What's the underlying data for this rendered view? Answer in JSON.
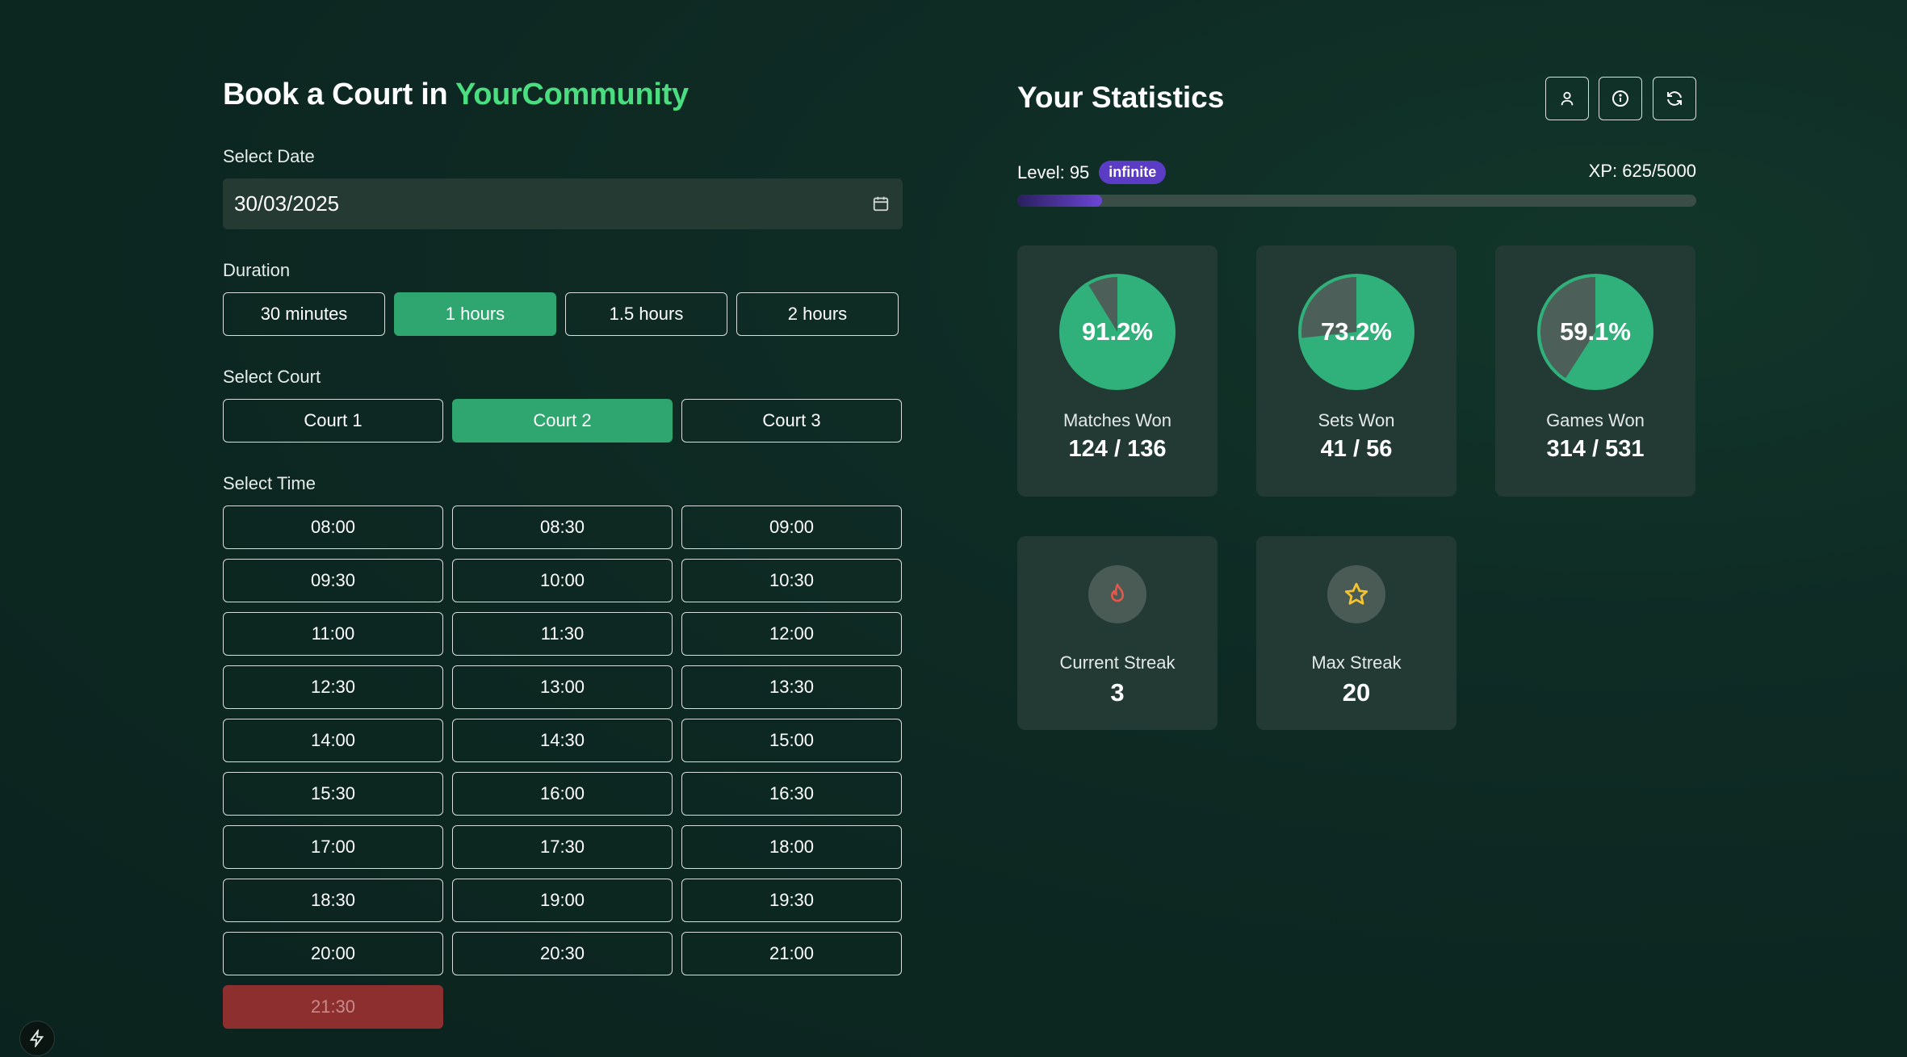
{
  "booking": {
    "title_prefix": "Book a Court in ",
    "title_accent": "YourCommunity",
    "date_label": "Select Date",
    "date_value": "30/03/2025",
    "duration_label": "Duration",
    "durations": [
      "30 minutes",
      "1 hours",
      "1.5 hours",
      "2 hours"
    ],
    "duration_selected": "1 hours",
    "court_label": "Select Court",
    "courts": [
      "Court 1",
      "Court 2",
      "Court 3"
    ],
    "court_selected": "Court 2",
    "time_label": "Select Time",
    "times": [
      "08:00",
      "08:30",
      "09:00",
      "09:30",
      "10:00",
      "10:30",
      "11:00",
      "11:30",
      "12:00",
      "12:30",
      "13:00",
      "13:30",
      "14:00",
      "14:30",
      "15:00",
      "15:30",
      "16:00",
      "16:30",
      "17:00",
      "17:30",
      "18:00",
      "18:30",
      "19:00",
      "19:30",
      "20:00",
      "20:30",
      "21:00",
      "21:30"
    ],
    "time_unavailable": "21:30"
  },
  "stats": {
    "title": "Your Statistics",
    "header_icons": [
      "user-icon",
      "info-icon",
      "refresh-icon"
    ],
    "level_text": "Level: 95",
    "badge": "infinite",
    "xp_text": "XP: 625/5000",
    "xp_fraction": 0.125,
    "cards": [
      {
        "percent": 91.2,
        "percent_label": "91.2%",
        "label": "Matches Won",
        "value": "124 / 136"
      },
      {
        "percent": 73.2,
        "percent_label": "73.2%",
        "label": "Sets Won",
        "value": "41 / 56"
      },
      {
        "percent": 59.1,
        "percent_label": "59.1%",
        "label": "Games Won",
        "value": "314 / 531"
      }
    ],
    "streaks": [
      {
        "icon": "flame-icon",
        "label": "Current Streak",
        "value": "3"
      },
      {
        "icon": "star-icon",
        "label": "Max Streak",
        "value": "20"
      }
    ]
  },
  "colors": {
    "accent": "#4ade80",
    "selected": "#2fa56f",
    "unavailable": "#8d2f2f",
    "pie_fill": "#30b07a",
    "pie_rest": "#4d5f59",
    "badge": "#5b3cc4"
  }
}
